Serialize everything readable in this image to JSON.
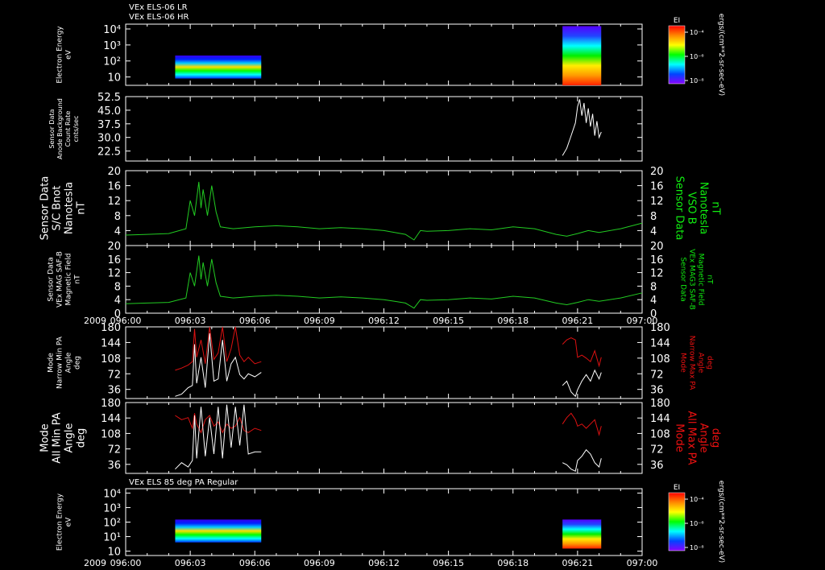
{
  "header": {
    "line1": "VEx ELS-06 LR",
    "line2": "VEx ELS-06 HR",
    "panel7_title": "VEx ELS 85 deg PA Regular"
  },
  "colors": {
    "background": "#000000",
    "frame": "#ffffff",
    "trace_white": "#ffffff",
    "trace_green": "#22cc22",
    "trace_red": "#dd1111",
    "label_green": "#11ee11",
    "label_red": "#ee1111"
  },
  "colorbars": [
    {
      "title": "EI",
      "ticks": [
        "10⁻⁴",
        "10⁻⁶",
        "10⁻⁸"
      ]
    },
    {
      "title": "EI",
      "ticks": [
        "10⁻⁴",
        "10⁻⁶",
        "10⁻⁸"
      ]
    }
  ],
  "colorbar_units": "ergs/(cm**2-sr-sec-eV)",
  "chart_data": [
    {
      "id": "p1",
      "type": "heatmap",
      "ylabel": [
        "Electron Energy",
        "eV"
      ],
      "yscale": "log",
      "yticks": [
        {
          "v": 10,
          "l": "10"
        },
        {
          "v": 100,
          "l": "10²"
        },
        {
          "v": 1000,
          "l": "10³"
        },
        {
          "v": 10000,
          "l": "10⁴"
        }
      ],
      "ylim": [
        3,
        20000
      ],
      "blocks": [
        {
          "x0": 2.3,
          "x1": 6.3,
          "ylo": 8,
          "yhi": 220
        },
        {
          "x0": 20.3,
          "x1": 22.1,
          "ylo": 3,
          "yhi": 15000
        }
      ]
    },
    {
      "id": "p2",
      "type": "line",
      "ylabel": [
        "Sensor Data",
        "Anode Background",
        "Count Rate",
        "cnts/sec"
      ],
      "yticks": [
        {
          "v": 22.5,
          "l": "22.5"
        },
        {
          "v": 30,
          "l": "30.0"
        },
        {
          "v": 37.5,
          "l": "37.5"
        },
        {
          "v": 45,
          "l": "45.0"
        },
        {
          "v": 52.5,
          "l": "52.5"
        }
      ],
      "ylim": [
        17,
        52.5
      ],
      "series": [
        {
          "color": "white",
          "x": [
            20.3,
            20.5,
            20.7,
            20.9,
            21.0,
            21.1,
            21.2,
            21.3,
            21.4,
            21.5,
            21.6,
            21.7,
            21.8,
            21.9,
            22.0,
            22.1
          ],
          "y": [
            20,
            24,
            31,
            38,
            47,
            51,
            42,
            49,
            38,
            46,
            36,
            43,
            31,
            39,
            30,
            33
          ]
        }
      ]
    },
    {
      "id": "p3",
      "type": "line",
      "ylabel": [
        "Sensor Data",
        "S/C Bnot",
        "Nanotesla",
        "nT"
      ],
      "ylabel_right": [
        "Sensor Data",
        "VSO B",
        "Nanotesla",
        "nT"
      ],
      "yticks": [
        {
          "v": 4,
          "l": "4"
        },
        {
          "v": 8,
          "l": "8"
        },
        {
          "v": 12,
          "l": "12"
        },
        {
          "v": 16,
          "l": "16"
        },
        {
          "v": 20,
          "l": "20"
        }
      ],
      "ylim": [
        0,
        20
      ],
      "series": [
        {
          "color": "green",
          "x": [
            0,
            1,
            2,
            2.8,
            3.0,
            3.2,
            3.4,
            3.5,
            3.6,
            3.8,
            4.0,
            4.2,
            4.4,
            5,
            6,
            7,
            8,
            9,
            10,
            11,
            12,
            12.5,
            13,
            13.4,
            13.7,
            14,
            15,
            16,
            17,
            18,
            19,
            20,
            20.5,
            21,
            21.5,
            22,
            23,
            24
          ],
          "y": [
            2.8,
            3,
            3.2,
            4.5,
            12,
            8,
            17,
            10,
            15,
            8,
            16,
            9,
            5,
            4.5,
            5,
            5.3,
            5,
            4.5,
            4.8,
            4.5,
            4,
            3.5,
            3,
            1.5,
            4,
            3.8,
            4,
            4.5,
            4.2,
            5,
            4.5,
            3,
            2.5,
            3.2,
            4,
            3.5,
            4.5,
            6
          ]
        }
      ]
    },
    {
      "id": "p4",
      "type": "line",
      "ylabel": [
        "Sensor Data",
        "VEx MAG SAF-B",
        "Magnetic Field",
        "nT"
      ],
      "ylabel_right": [
        "Sensor Data",
        "VEx MAG3 SAF-B",
        "Magnetic Field",
        "nT"
      ],
      "yticks": [
        {
          "v": 0,
          "l": "0"
        },
        {
          "v": 4,
          "l": "4"
        },
        {
          "v": 8,
          "l": "8"
        },
        {
          "v": 12,
          "l": "12"
        },
        {
          "v": 16,
          "l": "16"
        },
        {
          "v": 20,
          "l": "20"
        }
      ],
      "ylim": [
        0,
        20
      ],
      "series": [
        {
          "color": "green",
          "x": [
            0,
            1,
            2,
            2.8,
            3.0,
            3.2,
            3.4,
            3.5,
            3.6,
            3.8,
            4.0,
            4.2,
            4.4,
            5,
            6,
            7,
            8,
            9,
            10,
            11,
            12,
            12.5,
            13,
            13.4,
            13.7,
            14,
            15,
            16,
            17,
            18,
            19,
            20,
            20.5,
            21,
            21.5,
            22,
            23,
            24
          ],
          "y": [
            2.8,
            3,
            3.2,
            4.5,
            12,
            8,
            17,
            10,
            15,
            8,
            16,
            9,
            5,
            4.5,
            5,
            5.3,
            5,
            4.5,
            4.8,
            4.5,
            4,
            3.5,
            3,
            1.5,
            4,
            3.8,
            4,
            4.5,
            4.2,
            5,
            4.5,
            3,
            2.5,
            3.2,
            4,
            3.5,
            4.5,
            6
          ]
        }
      ]
    },
    {
      "id": "p5",
      "type": "line",
      "ylabel": [
        "Mode",
        "Narrow Min PA",
        "Angle",
        "deg"
      ],
      "ylabel_right": [
        "Mode",
        "Narrow Max PA",
        "Angle",
        "deg"
      ],
      "yticks": [
        {
          "v": 36,
          "l": "36"
        },
        {
          "v": 72,
          "l": "72"
        },
        {
          "v": 108,
          "l": "108"
        },
        {
          "v": 144,
          "l": "144"
        },
        {
          "v": 180,
          "l": "180"
        }
      ],
      "ylim": [
        15,
        180
      ],
      "series": [
        {
          "color": "red",
          "x": [
            2.3,
            2.6,
            2.9,
            3.1,
            3.2,
            3.3,
            3.5,
            3.7,
            3.9,
            4.1,
            4.3,
            4.5,
            4.7,
            4.9,
            5.1,
            5.3,
            5.5,
            5.7,
            6.0,
            6.3
          ],
          "y": [
            80,
            85,
            92,
            100,
            175,
            110,
            150,
            95,
            180,
            105,
            120,
            180,
            100,
            130,
            180,
            115,
            100,
            110,
            95,
            100
          ]
        },
        {
          "color": "white",
          "x": [
            2.3,
            2.6,
            2.9,
            3.1,
            3.2,
            3.3,
            3.5,
            3.7,
            3.9,
            4.1,
            4.3,
            4.5,
            4.7,
            4.9,
            5.1,
            5.3,
            5.5,
            5.7,
            6.0,
            6.3
          ],
          "y": [
            20,
            25,
            40,
            45,
            140,
            50,
            110,
            40,
            165,
            55,
            60,
            150,
            55,
            95,
            110,
            70,
            60,
            72,
            65,
            75
          ]
        },
        {
          "color": "red",
          "x": [
            20.3,
            20.5,
            20.7,
            20.9,
            21.0,
            21.2,
            21.4,
            21.6,
            21.8,
            22.0,
            22.1
          ],
          "y": [
            140,
            150,
            155,
            150,
            110,
            115,
            108,
            100,
            125,
            90,
            110
          ]
        },
        {
          "color": "white",
          "x": [
            20.3,
            20.5,
            20.7,
            20.9,
            21.0,
            21.2,
            21.4,
            21.6,
            21.8,
            22.0,
            22.1
          ],
          "y": [
            45,
            55,
            30,
            20,
            35,
            55,
            70,
            55,
            80,
            60,
            75
          ]
        }
      ]
    },
    {
      "id": "p6",
      "type": "line",
      "ylabel": [
        "Mode",
        "All Min PA",
        "Angle",
        "deg"
      ],
      "ylabel_right": [
        "Mode",
        "All Max PA",
        "Angle",
        "deg"
      ],
      "yticks": [
        {
          "v": 36,
          "l": "36"
        },
        {
          "v": 72,
          "l": "72"
        },
        {
          "v": 108,
          "l": "108"
        },
        {
          "v": 144,
          "l": "144"
        },
        {
          "v": 180,
          "l": "180"
        }
      ],
      "ylim": [
        15,
        180
      ],
      "series": [
        {
          "color": "red",
          "x": [
            2.3,
            2.6,
            2.9,
            3.1,
            3.2,
            3.3,
            3.5,
            3.7,
            3.9,
            4.1,
            4.3,
            4.5,
            4.7,
            4.9,
            5.1,
            5.3,
            5.5,
            5.7,
            6.0,
            6.3
          ],
          "y": [
            150,
            140,
            145,
            120,
            155,
            130,
            110,
            140,
            150,
            125,
            135,
            110,
            130,
            120,
            125,
            145,
            115,
            110,
            120,
            115
          ]
        },
        {
          "color": "white",
          "x": [
            2.3,
            2.6,
            2.9,
            3.1,
            3.2,
            3.3,
            3.5,
            3.7,
            3.9,
            4.1,
            4.3,
            4.5,
            4.7,
            4.9,
            5.1,
            5.3,
            5.5,
            5.7,
            6.0,
            6.3
          ],
          "y": [
            25,
            40,
            30,
            45,
            150,
            50,
            170,
            55,
            145,
            60,
            170,
            50,
            175,
            75,
            170,
            80,
            175,
            60,
            65,
            65
          ]
        },
        {
          "color": "red",
          "x": [
            20.3,
            20.5,
            20.7,
            20.9,
            21.0,
            21.2,
            21.4,
            21.6,
            21.8,
            22.0,
            22.1
          ],
          "y": [
            130,
            145,
            155,
            140,
            125,
            130,
            120,
            130,
            140,
            105,
            125
          ]
        },
        {
          "color": "white",
          "x": [
            20.3,
            20.5,
            20.7,
            20.9,
            21.0,
            21.2,
            21.4,
            21.6,
            21.8,
            22.0,
            22.1
          ],
          "y": [
            40,
            35,
            25,
            20,
            45,
            55,
            70,
            60,
            40,
            30,
            50
          ]
        }
      ]
    },
    {
      "id": "p7",
      "type": "heatmap",
      "ylabel": [
        "Electron Energy",
        "eV"
      ],
      "yscale": "log",
      "yticks": [
        {
          "v": 1,
          "l": "10"
        },
        {
          "v": 10,
          "l": "10¹"
        },
        {
          "v": 100,
          "l": "10²"
        },
        {
          "v": 1000,
          "l": "10³"
        },
        {
          "v": 10000,
          "l": "10⁴"
        }
      ],
      "ylim": [
        0.5,
        20000
      ],
      "blocks": [
        {
          "x0": 2.3,
          "x1": 6.3,
          "ylo": 4,
          "yhi": 150
        },
        {
          "x0": 20.3,
          "x1": 22.1,
          "ylo": 1.5,
          "yhi": 150
        }
      ]
    }
  ],
  "x_axis": {
    "year": "2009",
    "xlim": [
      0,
      24
    ],
    "tick_labels": [
      "096:00",
      "096:03",
      "096:06",
      "096:09",
      "096:12",
      "096:15",
      "096:18",
      "096:21",
      "097:00"
    ]
  }
}
